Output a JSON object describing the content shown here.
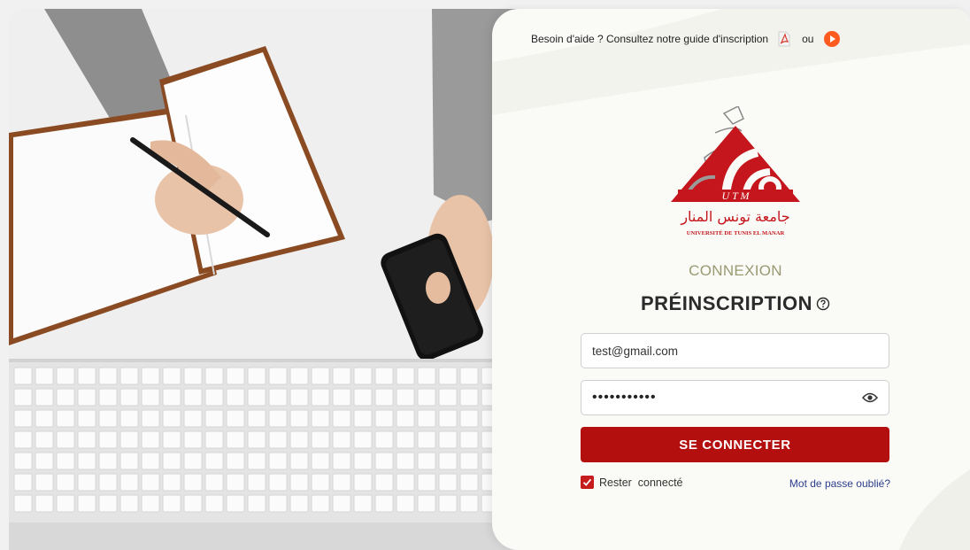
{
  "help": {
    "text": "Besoin d'aide ? Consultez notre guide d'inscription",
    "or_text": "ou",
    "pdf_icon": "pdf-icon",
    "play_icon": "play-icon"
  },
  "logo": {
    "letters": "U T M",
    "arabic": "جامعة تونس المنار",
    "name": "UNIVERSITÉ DE TUNIS EL MANAR"
  },
  "form": {
    "subtitle": "CONNEXION",
    "title": "PRÉINSCRIPTION",
    "email_value": "test@gmail.com",
    "password_value": "•••••••••••",
    "submit_label": "SE CONNECTER",
    "remember_label": "Rester  connecté",
    "forgot_label": "Mot de passe oublié?"
  },
  "colors": {
    "brand_red": "#b40f0f",
    "link_blue": "#2c3e8c",
    "subtitle_olive": "#9a9a72"
  }
}
